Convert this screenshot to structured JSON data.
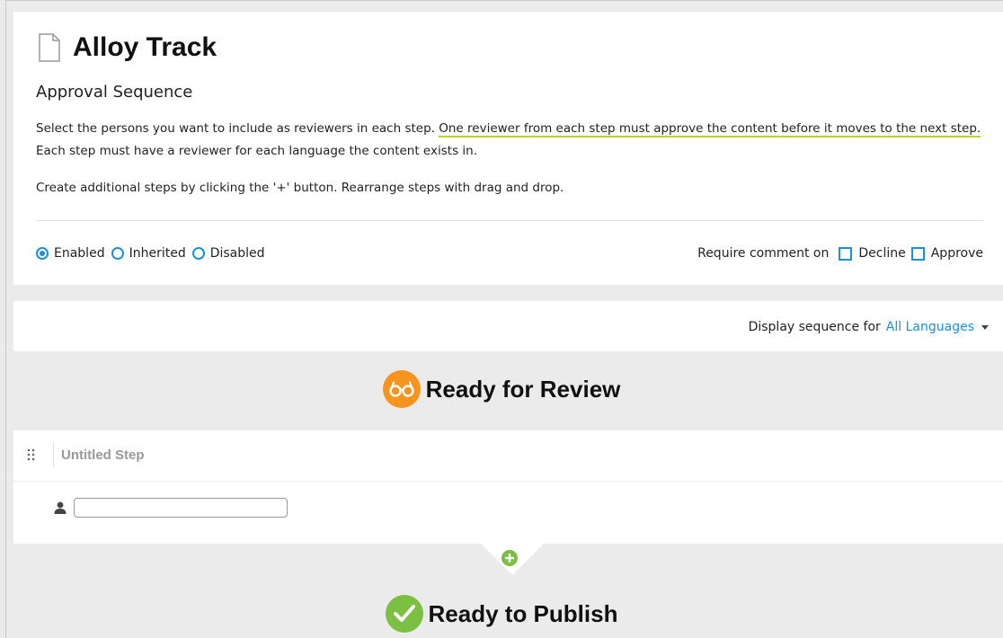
{
  "page": {
    "title": "Alloy Track",
    "subtitle": "Approval Sequence",
    "description_part1": "Select the persons you want to include as reviewers in each step. ",
    "description_highlight": "One reviewer from each step must approve the content before it moves to the next step.",
    "description_part2": " Each step must have a reviewer for each language the content exists in.",
    "description_line2": "Create additional steps by clicking the '+' button. Rearrange steps with drag and drop."
  },
  "mode": {
    "options": [
      {
        "label": "Enabled",
        "selected": true
      },
      {
        "label": "Inherited",
        "selected": false
      },
      {
        "label": "Disabled",
        "selected": false
      }
    ]
  },
  "require_comment": {
    "label": "Require comment on",
    "options": [
      {
        "label": "Decline",
        "checked": false
      },
      {
        "label": "Approve",
        "checked": false
      }
    ]
  },
  "sequence": {
    "label": "Display sequence for",
    "language": "All Languages"
  },
  "statuses": {
    "review": "Ready for Review",
    "publish": "Ready to Publish"
  },
  "step": {
    "name": "Untitled Step",
    "reviewer_value": ""
  },
  "colors": {
    "accent": "#1e8fd8",
    "review_icon": "#f7941d",
    "publish_icon": "#7bc043",
    "highlight_underline": "#b6d334"
  }
}
